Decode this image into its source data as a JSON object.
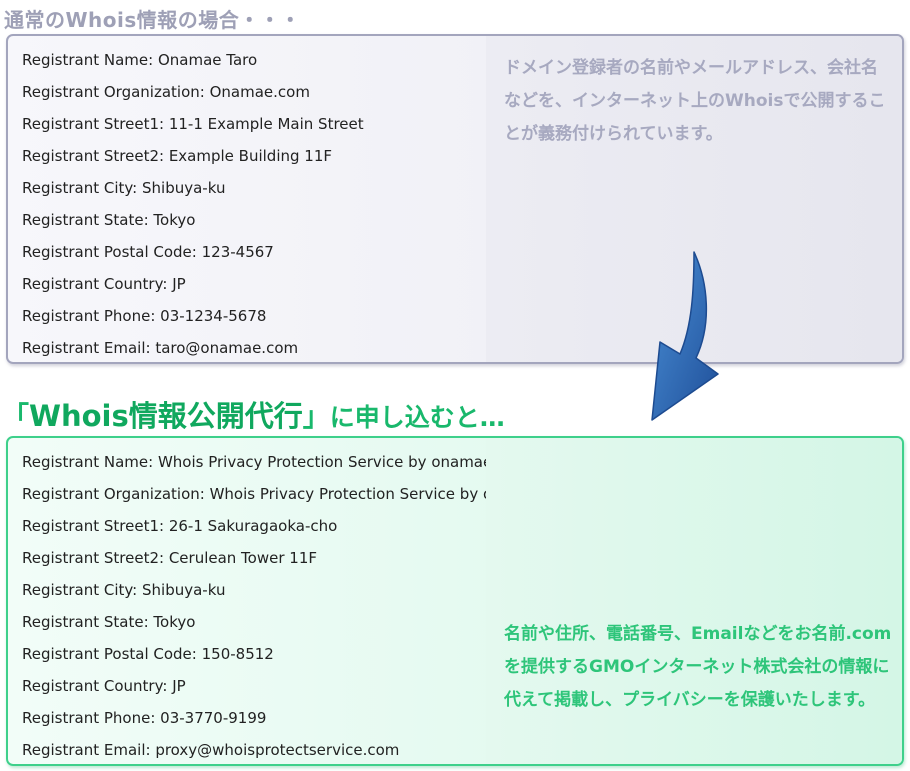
{
  "before": {
    "heading": "通常のWhois情報の場合・・・",
    "fields": [
      "Registrant Name: Onamae Taro",
      "Registrant Organization: Onamae.com",
      "Registrant Street1: 11-1 Example Main Street",
      "Registrant Street2: Example Building 11F",
      "Registrant City: Shibuya-ku",
      "Registrant State: Tokyo",
      "Registrant Postal Code: 123-4567",
      "Registrant Country: JP",
      "Registrant Phone: 03-1234-5678",
      "Registrant Email: taro@onamae.com"
    ],
    "note": "ドメイン登録者の名前やメールアドレス、会社名などを、インターネット上のWhoisで公開することが義務付けられています。"
  },
  "after": {
    "heading_open": "「",
    "heading_emphasis": "Whois情報公開代行",
    "heading_close": "」",
    "heading_rest": "に申し込むと…",
    "fields": [
      "Registrant Name: Whois Privacy Protection Service by onamae.com",
      "Registrant Organization: Whois Privacy Protection Service by onamae.com",
      "Registrant Street1: 26-1 Sakuragaoka-cho",
      "Registrant Street2: Cerulean Tower 11F",
      "Registrant City: Shibuya-ku",
      "Registrant State: Tokyo",
      "Registrant Postal Code: 150-8512",
      "Registrant Country: JP",
      "Registrant Phone: 03-3770-9199",
      "Registrant Email: proxy@whoisprotectservice.com"
    ],
    "note": "名前や住所、電話番号、Emailなどをお名前.comを提供するGMOインターネット株式会社の情報に代えて掲載し、プライバシーを保護いたします。"
  },
  "colors": {
    "before_border": "#a3a5bd",
    "after_border": "#3ed08b",
    "arrow": "#2f6cb5",
    "accent_green": "#19b86c"
  },
  "icons": {
    "transition": "curved-down-arrow-icon"
  }
}
